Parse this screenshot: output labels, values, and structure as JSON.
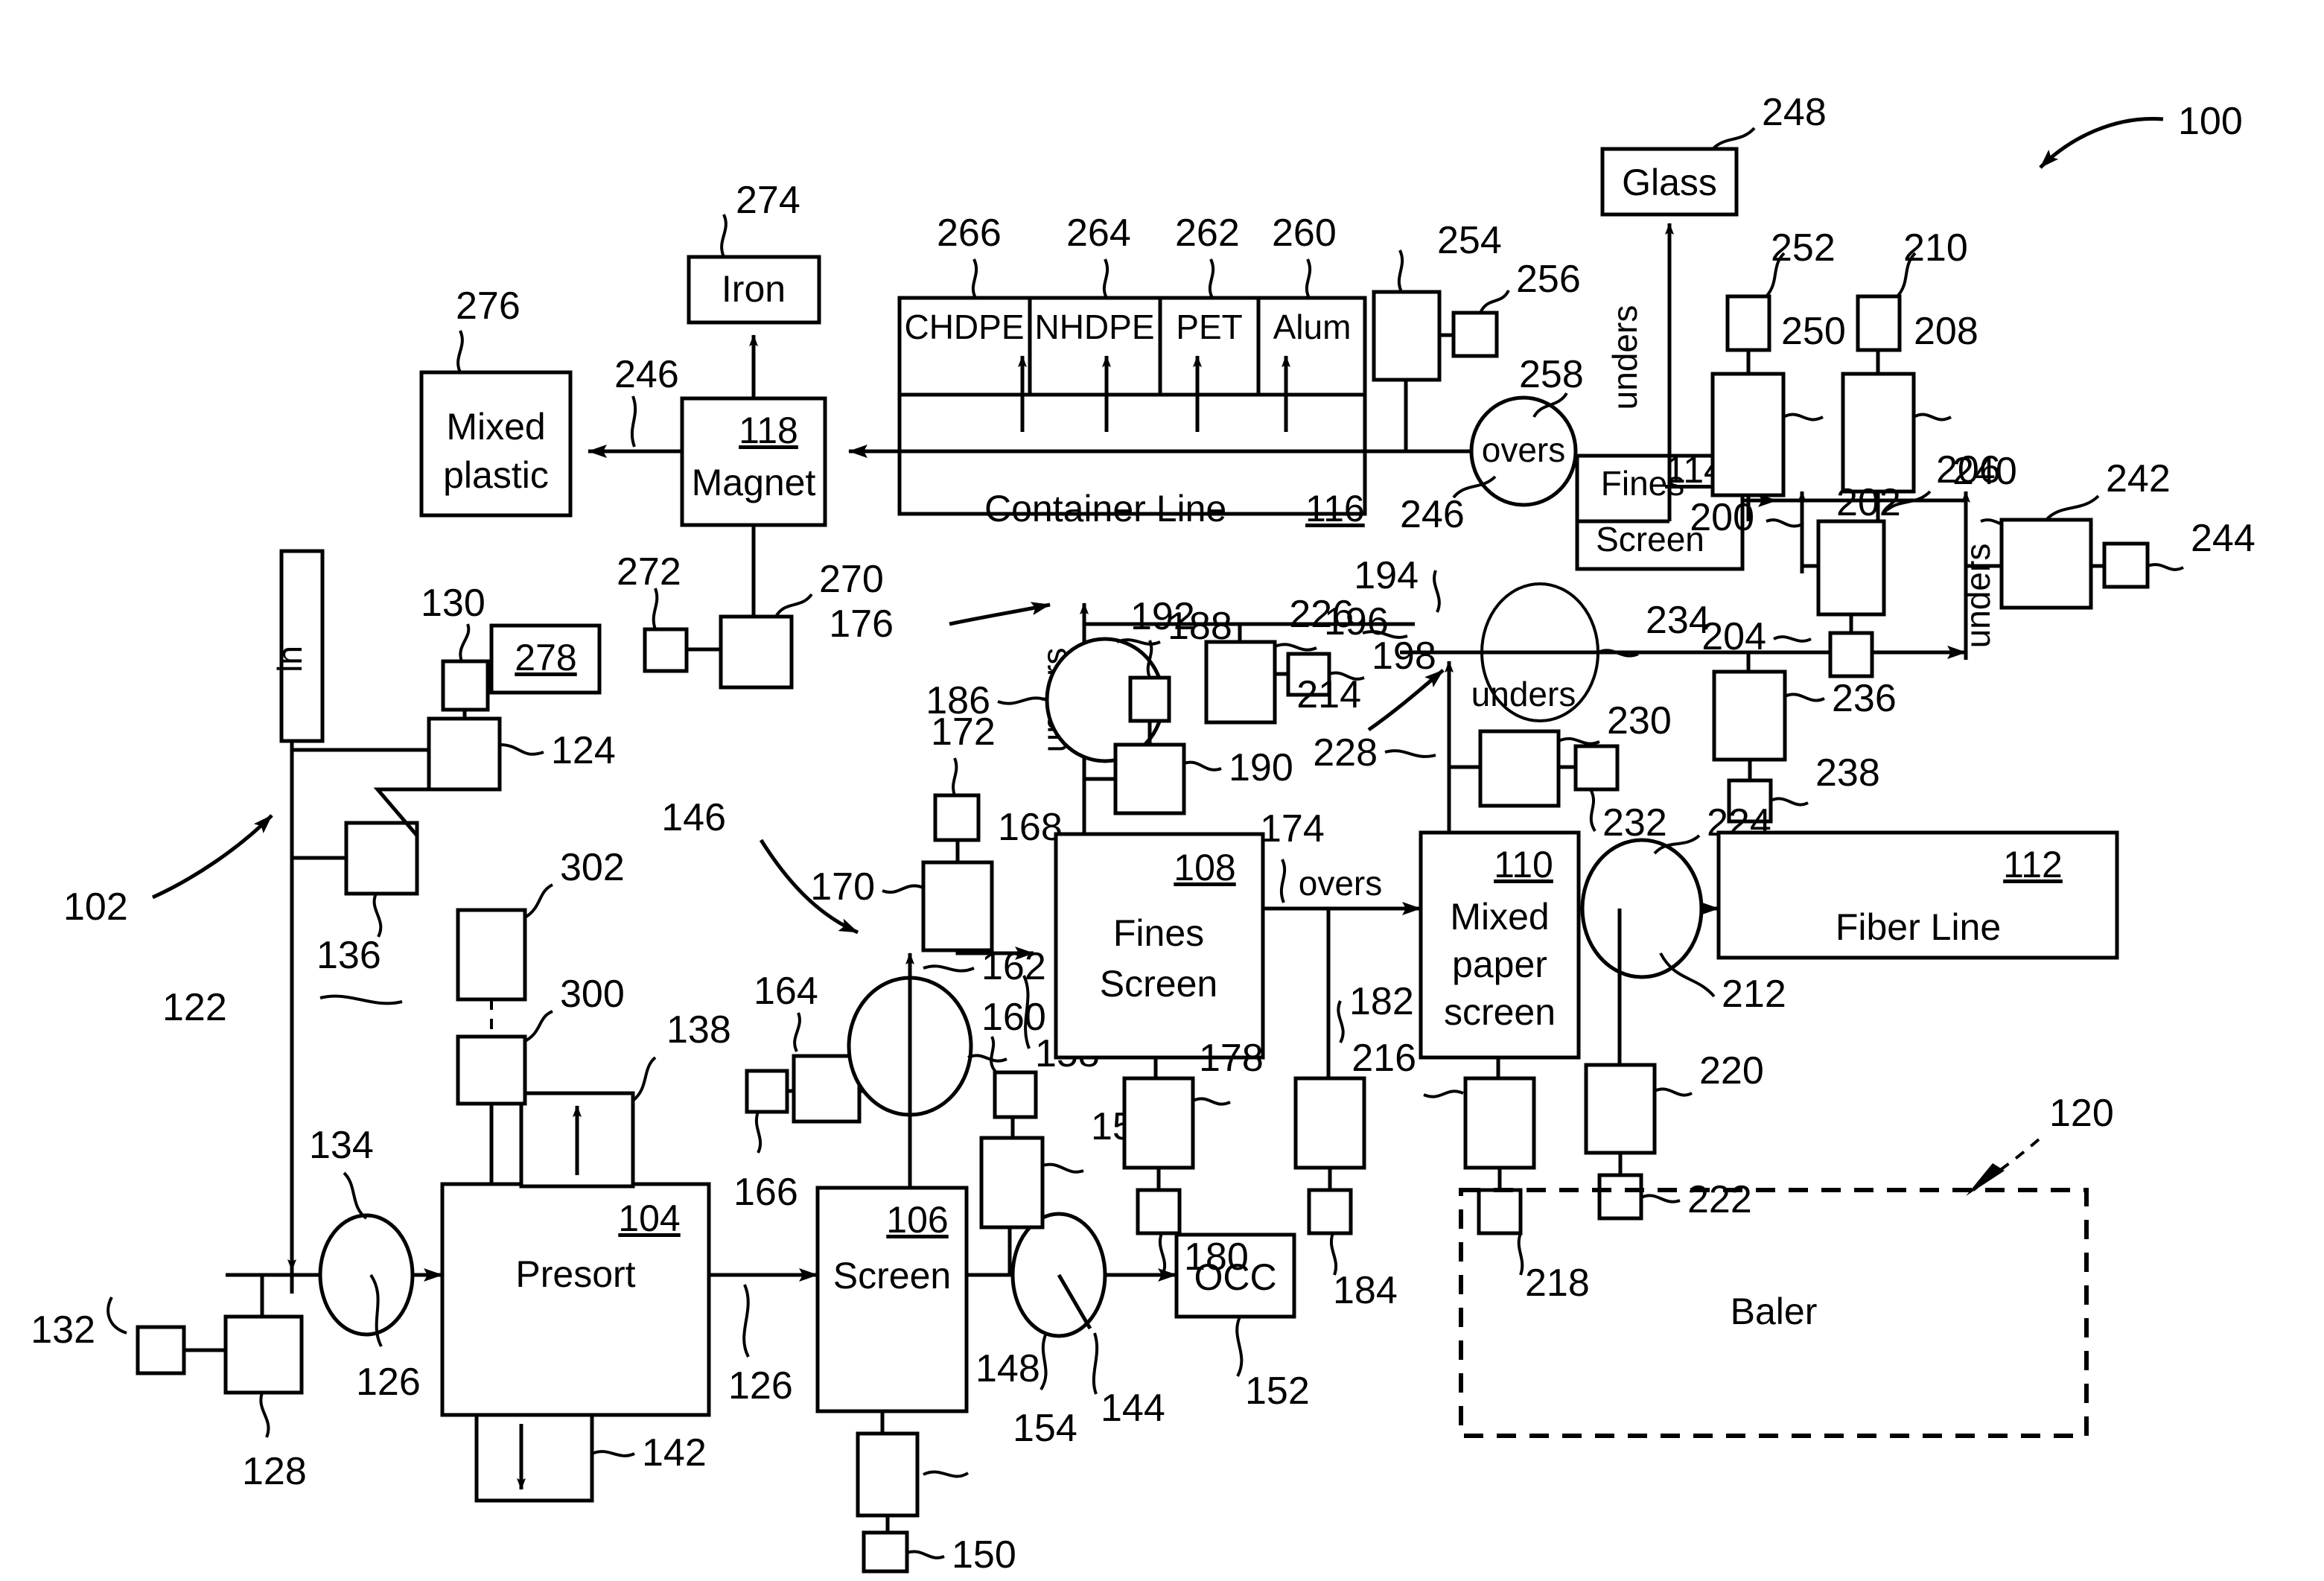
{
  "figure": {
    "system_ref": "100",
    "incoming_ref": "102",
    "baler_group_ref": "120"
  },
  "process_boxes": [
    {
      "id": "presort",
      "label": "Presort",
      "ref": "104"
    },
    {
      "id": "screen",
      "label": "Screen",
      "ref": "106"
    },
    {
      "id": "fines108",
      "label": "Fines Screen",
      "ref": "108"
    },
    {
      "id": "mixedpaper",
      "label": "Mixed paper screen",
      "ref": "110"
    },
    {
      "id": "fiberline",
      "label": "Fiber Line",
      "ref": "112"
    },
    {
      "id": "fines114",
      "label": "Fines Screen",
      "ref": "114"
    },
    {
      "id": "container",
      "label": "Container Line",
      "ref": "116"
    },
    {
      "id": "magnet",
      "label": "Magnet",
      "ref": "118"
    },
    {
      "id": "baler",
      "label": "Baler",
      "ref": "120"
    }
  ],
  "output_boxes": [
    {
      "id": "occ",
      "label": "OCC",
      "ref": "152"
    },
    {
      "id": "glass",
      "label": "Glass",
      "ref": "248"
    },
    {
      "id": "iron",
      "label": "Iron",
      "ref": "274"
    },
    {
      "id": "mixedplastic",
      "label": "Mixed plastic",
      "ref": "276"
    },
    {
      "id": "infeed",
      "label": "in",
      "ref": "122"
    }
  ],
  "container_line_cells": [
    {
      "label": "CHDPE",
      "ref": "266"
    },
    {
      "label": "NHDPE",
      "ref": "264"
    },
    {
      "label": "PET",
      "ref": "262"
    },
    {
      "label": "Alum",
      "ref": "260"
    }
  ],
  "flow_labels": [
    {
      "id": "f1",
      "text": "unders",
      "orient": "vertical"
    },
    {
      "id": "f2",
      "text": "unders",
      "orient": "vertical"
    },
    {
      "id": "f3",
      "text": "unders",
      "orient": "vertical"
    },
    {
      "id": "f4",
      "text": "unders",
      "orient": "horizontal"
    },
    {
      "id": "f5",
      "text": "overs",
      "orient": "horizontal"
    },
    {
      "id": "f6",
      "text": "overs",
      "orient": "horizontal"
    }
  ],
  "reference_numerals": [
    "100",
    "102",
    "104",
    "106",
    "108",
    "110",
    "112",
    "114",
    "116",
    "118",
    "120",
    "122",
    "124",
    "126",
    "126",
    "128",
    "130",
    "132",
    "134",
    "136",
    "138",
    "142",
    "144",
    "146",
    "148",
    "150",
    "152",
    "154",
    "156",
    "158",
    "160",
    "162",
    "164",
    "166",
    "168",
    "170",
    "172",
    "174",
    "176",
    "178",
    "180",
    "182",
    "184",
    "186",
    "188",
    "190",
    "192",
    "194",
    "196",
    "198",
    "200",
    "202",
    "204",
    "206",
    "208",
    "210",
    "212",
    "214",
    "216",
    "218",
    "220",
    "222",
    "224",
    "226",
    "228",
    "230",
    "232",
    "234",
    "236",
    "238",
    "240",
    "242",
    "244",
    "246",
    "246",
    "248",
    "250",
    "252",
    "254",
    "256",
    "258",
    "260",
    "262",
    "264",
    "266",
    "270",
    "272",
    "274",
    "276",
    "278",
    "300",
    "302"
  ],
  "standalone_refs": [
    {
      "ref": "278",
      "boxed": true,
      "underlined": true
    }
  ],
  "colors": {
    "ink": "#000000",
    "paper": "#ffffff"
  }
}
